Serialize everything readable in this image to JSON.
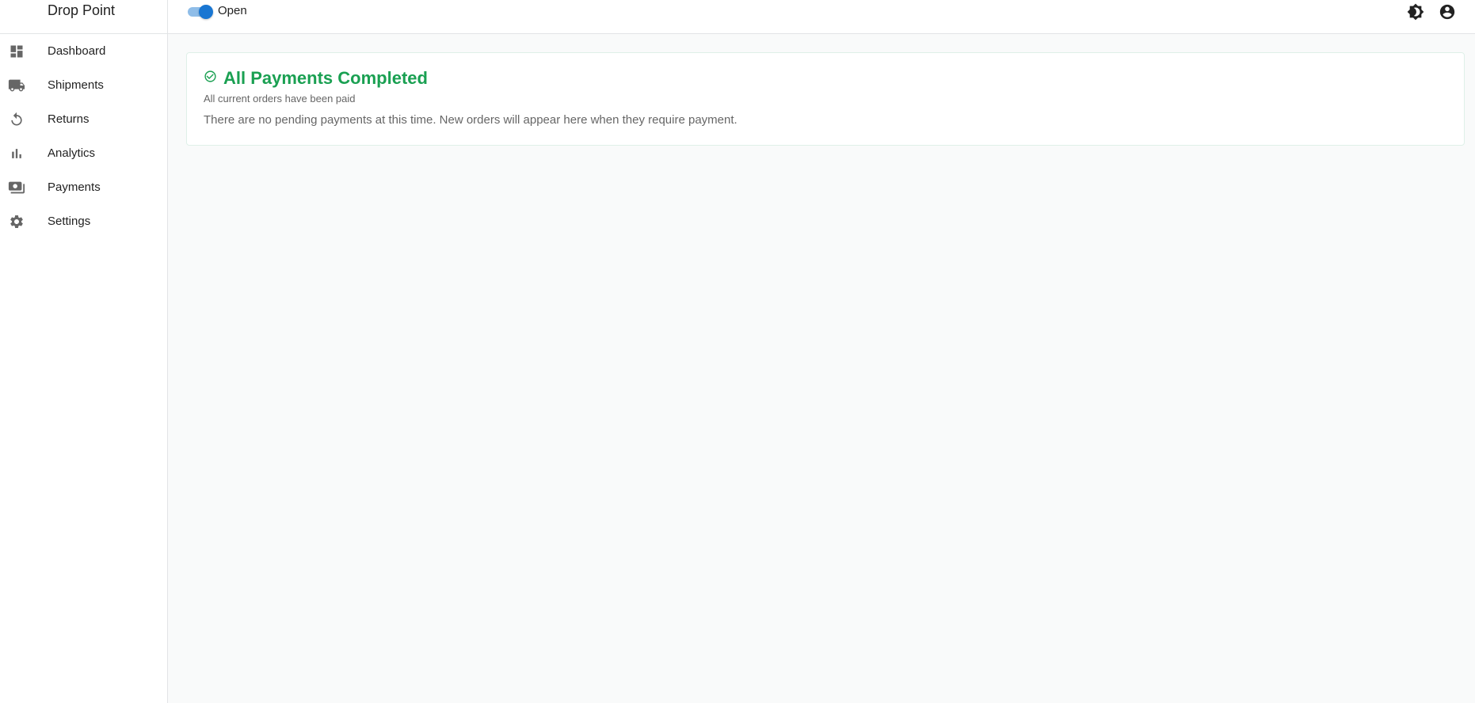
{
  "app": {
    "title": "Drop Point"
  },
  "sidebar": {
    "items": [
      {
        "label": "Dashboard",
        "icon": "dashboard-icon"
      },
      {
        "label": "Shipments",
        "icon": "truck-icon"
      },
      {
        "label": "Returns",
        "icon": "undo-icon"
      },
      {
        "label": "Analytics",
        "icon": "bar-chart-icon"
      },
      {
        "label": "Payments",
        "icon": "payments-icon"
      },
      {
        "label": "Settings",
        "icon": "gear-icon"
      }
    ]
  },
  "topbar": {
    "status_toggle": {
      "label": "Open",
      "on": true
    },
    "icons": [
      "brightness-icon",
      "account-circle-icon"
    ]
  },
  "card": {
    "title": "All Payments Completed",
    "subtitle": "All current orders have been paid",
    "message": "There are no pending payments at this time. New orders will appear here when they require payment."
  },
  "colors": {
    "accent_green": "#1aa052",
    "toggle_blue": "#1976d2",
    "toggle_track": "#8fbde8",
    "icon_gray": "#666666"
  }
}
